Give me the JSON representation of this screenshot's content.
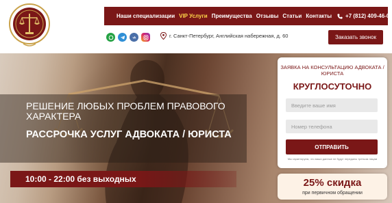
{
  "header": {
    "nav": [
      {
        "label": "Наши специализации",
        "highlight": false
      },
      {
        "label": "VIP Услуги",
        "highlight": true
      },
      {
        "label": "Преимущества",
        "highlight": false
      },
      {
        "label": "Отзывы",
        "highlight": false
      },
      {
        "label": "Статьи",
        "highlight": false
      },
      {
        "label": "Контакты",
        "highlight": false
      }
    ],
    "phone": "+7 (812) 409-46-00",
    "address": "г. Санкт-Петербург, Английская набережная, д. 60",
    "callback_label": "Заказать звонок",
    "social_icons": [
      "whatsapp-icon",
      "telegram-icon",
      "vk-icon",
      "instagram-icon"
    ]
  },
  "hero": {
    "line1": "Решение любых проблем правового характера",
    "line2": "Рассрочка услуг адвоката / юриста",
    "hours": "10:00 - 22:00 без выходных"
  },
  "form": {
    "subtitle": "Заявка на консультацию адвоката / юриста",
    "title": "КРУГЛОСУТОЧНО",
    "name_placeholder": "Введите ваше имя",
    "phone_placeholder": "Номер телефона",
    "submit_label": "ОТПРАВИТЬ",
    "consent": "Мы гарантируем, что ваши данные не будут переданы третьим лицам"
  },
  "discount": {
    "headline": "25% скидка",
    "caption": "при первичном обращении"
  },
  "colors": {
    "brand": "#7a1717",
    "vip": "#ffd84a",
    "background": "#ffffff"
  }
}
